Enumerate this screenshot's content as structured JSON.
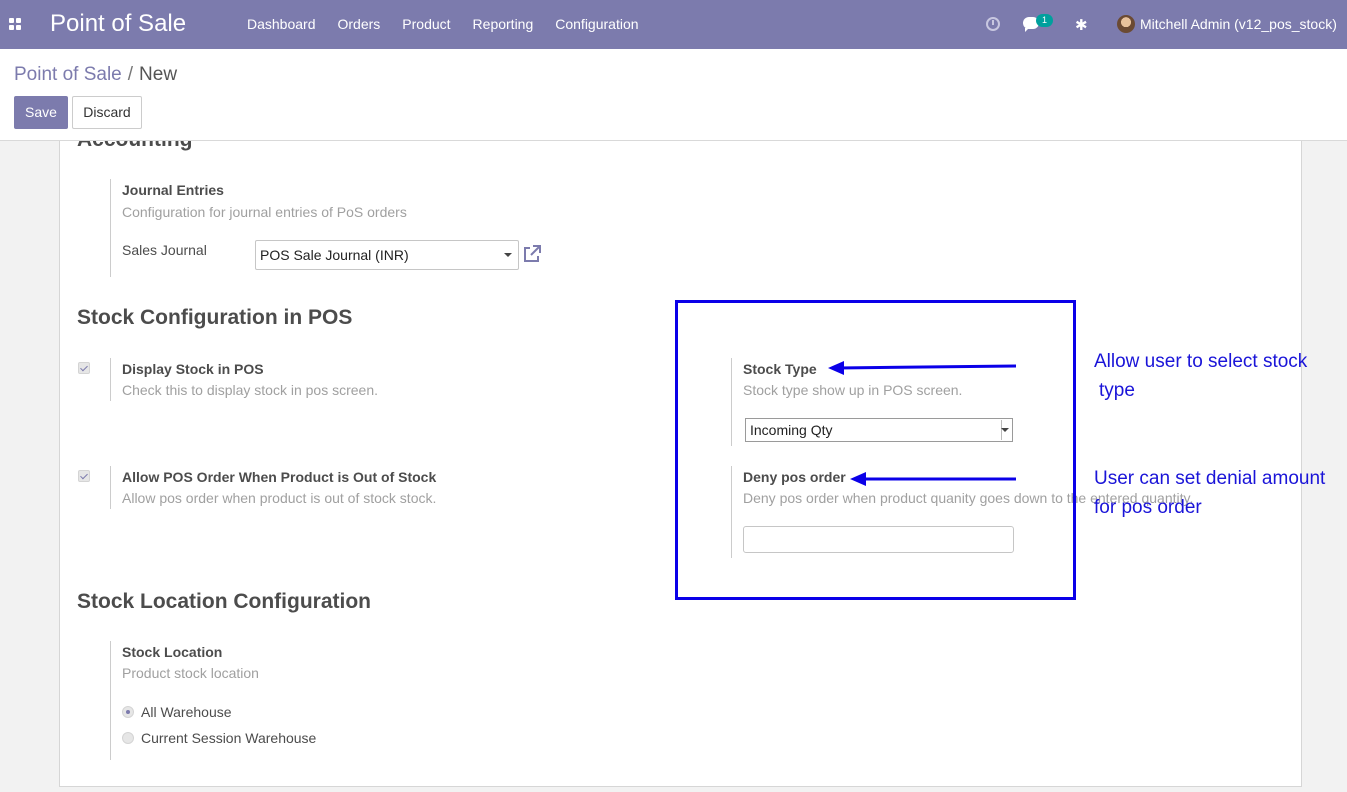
{
  "navbar": {
    "brand": "Point of Sale",
    "menu": [
      "Dashboard",
      "Orders",
      "Product",
      "Reporting",
      "Configuration"
    ],
    "chat_count": "1",
    "user": "Mitchell Admin (v12_pos_stock)"
  },
  "breadcrumb": {
    "parent": "Point of Sale",
    "separator": "/",
    "current": "New"
  },
  "buttons": {
    "save": "Save",
    "discard": "Discard"
  },
  "accounting": {
    "title": "Accounting",
    "journal_entries": {
      "label": "Journal Entries",
      "help": "Configuration for journal entries of PoS orders",
      "sales_journal_label": "Sales Journal",
      "sales_journal_value": "POS Sale Journal (INR)"
    }
  },
  "stock_config": {
    "title": "Stock Configuration in POS",
    "display_stock": {
      "label": "Display Stock in POS",
      "help": "Check this to display stock in pos screen.",
      "checked": true
    },
    "allow_order": {
      "label": "Allow POS Order When Product is Out of Stock",
      "help": "Allow pos order when product is out of stock stock.",
      "checked": true
    },
    "stock_type": {
      "label": "Stock Type",
      "help": "Stock type show up in POS screen.",
      "value": "Incoming Qty"
    },
    "deny_order": {
      "label": "Deny pos order",
      "help": "Deny pos order when product quanity goes down to the entered quantity.",
      "value": ""
    }
  },
  "stock_location": {
    "title": "Stock Location Configuration",
    "label": "Stock Location",
    "help": "Product stock location",
    "options": [
      {
        "label": "All Warehouse",
        "selected": true
      },
      {
        "label": "Current Session Warehouse",
        "selected": false
      }
    ]
  },
  "annotations": {
    "stock_type_line1": "Allow user to select stock",
    "stock_type_line2": "type",
    "deny_line1": "User can set denial amount",
    "deny_line2": "for pos order",
    "color": "#0b00e8"
  },
  "colors": {
    "brand": "#7c7bad",
    "badge": "#00a09d"
  }
}
